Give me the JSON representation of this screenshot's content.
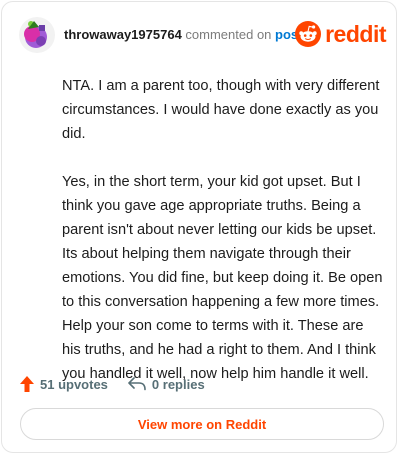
{
  "comment": {
    "username": "throwaway1975764",
    "commented_on_text": "commented on",
    "post_link": "post",
    "paragraphs": [
      "NTA. I am a parent too, though with very different circumstances. I would have done exactly as you did.",
      "Yes, in the short term, your kid got upset. But I think you gave age appropriate truths. Being a parent isn't about never letting our kids be upset. Its about helping them navigate through their emotions. You did fine, but keep doing it. Be open to this conversation happening a few more times. Help your son come to terms with it. These are his truths, and he had a right to them. And I think you handled it well, now help him handle it well."
    ]
  },
  "brand": {
    "logo_text": "reddit",
    "color": "#ff4500"
  },
  "actions": {
    "upvotes": "51 upvotes",
    "replies": "0 replies"
  },
  "footer": {
    "view_more": "View more on Reddit"
  }
}
